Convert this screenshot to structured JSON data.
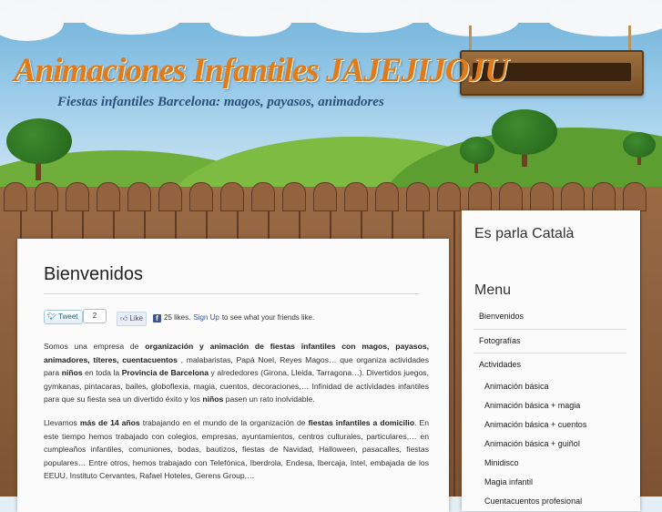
{
  "site": {
    "title": "Animaciones Infantiles JAJEJIJOJU",
    "tagline": "Fiestas infantiles Barcelona: magos, payasos, animadores"
  },
  "social": {
    "tweet_label": "Tweet",
    "tweet_count": "2",
    "like_label": "Like",
    "like_count_text": "25 likes.",
    "signup_link": "Sign Up",
    "signup_suffix": "to see what your friends like."
  },
  "main": {
    "heading": "Bienvenidos",
    "paragraph1": [
      {
        "t": "Somos una empresa de ",
        "b": false
      },
      {
        "t": "organización y animación de fiestas infantiles con magos, payasos, animadores, títeres, cuentacuentos",
        "b": true
      },
      {
        "t": " , malabaristas, Papá Noel, Reyes Magos… que organiza actividades para ",
        "b": false
      },
      {
        "t": "niños",
        "b": true
      },
      {
        "t": " en toda la ",
        "b": false
      },
      {
        "t": "Provincia de Barcelona",
        "b": true
      },
      {
        "t": " y alrededores (Girona, Lleida, Tarragona…). Divertidos juegos, gymkanas, pintacaras, bailes, globoflexia, magia, cuentos, decoraciones,… Infinidad de actividades infantiles para que su fiesta sea un divertido éxito y los ",
        "b": false
      },
      {
        "t": "niños",
        "b": true
      },
      {
        "t": " pasen un rato inolvidable.",
        "b": false
      }
    ],
    "paragraph2": [
      {
        "t": "Llevamos ",
        "b": false
      },
      {
        "t": "más de 14 años",
        "b": true
      },
      {
        "t": " trabajando en el mundo de la organización de ",
        "b": false
      },
      {
        "t": "fiestas infantiles a domicilio",
        "b": true
      },
      {
        "t": ". En este tiempo hemos trabajado con colegios, empresas, ayuntamientos, centros culturales, particulares,… en cumpleaños infantiles, comuniones, bodas, bautizos, fiestas de Navidad, Halloween, pasacalles, fiestas populares… Entre otros, hemos trabajado con Telefónica, Iberdrola, Endesa, Ibercaja, Intel, embajada de los EEUU, Instituto Cervantes, Rafael Hoteles, Gerens Group,…",
        "b": false
      }
    ]
  },
  "sidebar": {
    "language_link": "Es parla Català",
    "menu_title": "Menu",
    "menu_items": [
      {
        "label": "Bienvenidos",
        "level": "top"
      },
      {
        "label": "Fotografías",
        "level": "top"
      },
      {
        "label": "Actividades",
        "level": "top"
      },
      {
        "label": "Animación básica",
        "level": "sub"
      },
      {
        "label": "Animación básica + magia",
        "level": "sub"
      },
      {
        "label": "Animación básica + cuentos",
        "level": "sub"
      },
      {
        "label": "Animación básica + guiñol",
        "level": "sub"
      },
      {
        "label": "Minidisco",
        "level": "sub"
      },
      {
        "label": "Magia infantil",
        "level": "sub"
      },
      {
        "label": "Cuentacuentos profesional",
        "level": "sub"
      }
    ]
  },
  "colors": {
    "title": "#e07a1a",
    "tagline": "#2d4f7a",
    "facebook": "#3b5998",
    "twitter": "#186487"
  }
}
